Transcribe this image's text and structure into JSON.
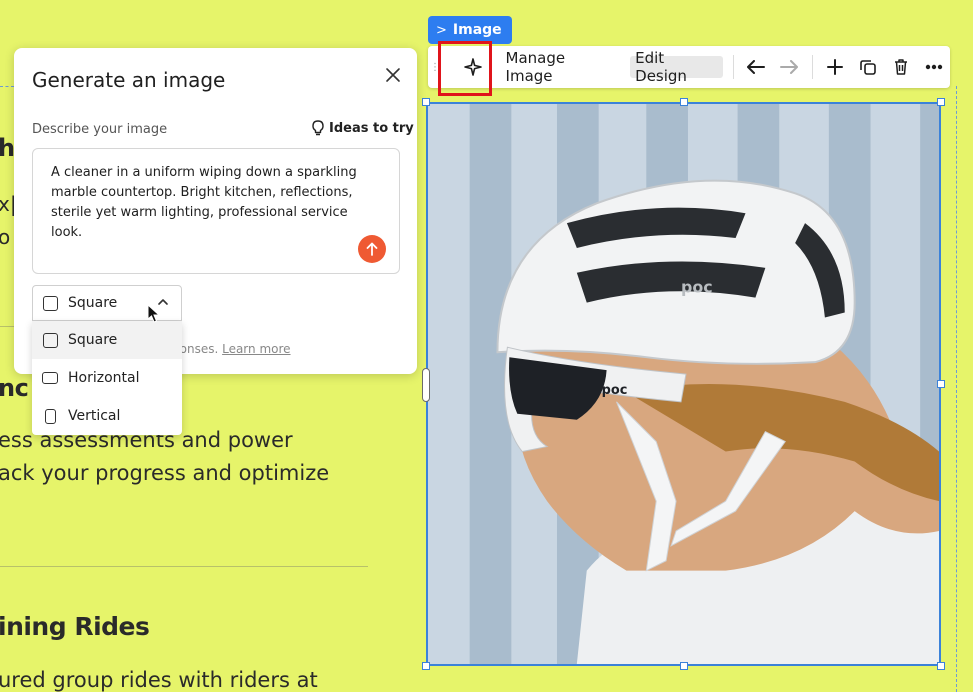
{
  "background_texts": {
    "frag_a": "h",
    "frag_b": "x|",
    "frag_c": "o",
    "frag_d": "nc",
    "body_1": "ess assessments and power",
    "body_2": "ack your progress and optimize",
    "heading_2": "ining Rides",
    "body_3": "ured group rides with riders at"
  },
  "element_tag": {
    "label": "Image",
    "chevron": ">"
  },
  "toolbar": {
    "ai_icon": "sparkle-icon",
    "manage_label": "Manage Image",
    "edit_label": "Edit Design",
    "icons": [
      "arrow-left-icon",
      "arrow-right-icon",
      "plus-icon",
      "duplicate-icon",
      "trash-icon",
      "more-icon"
    ]
  },
  "generate_panel": {
    "title": "Generate an image",
    "describe_label": "Describe your image",
    "ideas_label": "Ideas to try",
    "prompt": "A cleaner in a uniform wiping down a sparkling\nmarble countertop. Bright kitchen, reflections,\nsterile yet warm lighting, professional service look.",
    "footer_text": "ponses.",
    "learn_more": "Learn more"
  },
  "aspect_select": {
    "selected": "Square",
    "options": [
      "Square",
      "Horizontal",
      "Vertical"
    ]
  },
  "image": {
    "helmet_logo_top": "poc",
    "glasses_logo": "poc"
  },
  "colors": {
    "accent": "#2d7df0",
    "send": "#ef5a33",
    "highlight": "#e0141b",
    "page": "#e6f46a"
  }
}
